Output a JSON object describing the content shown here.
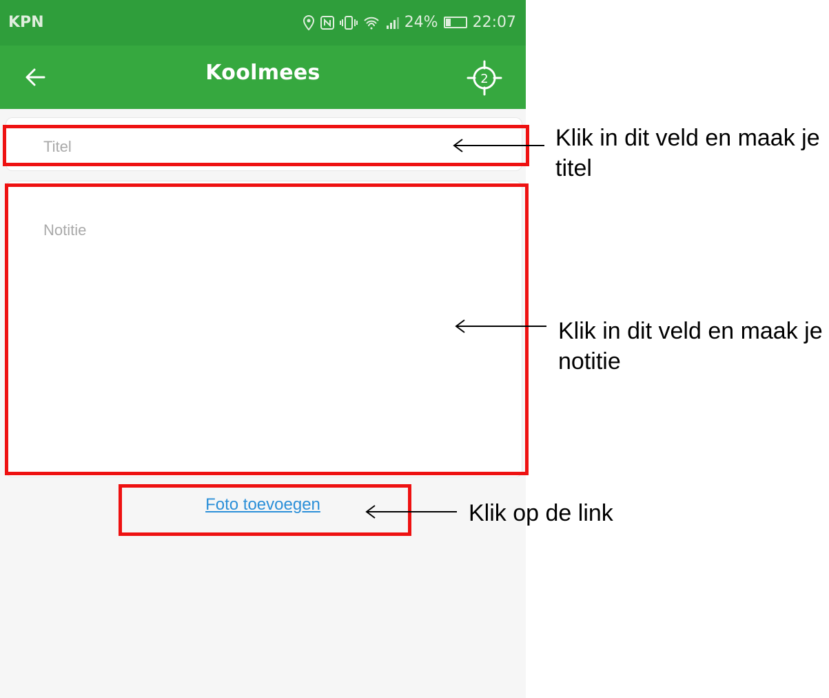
{
  "status_bar": {
    "carrier": "KPN",
    "battery_percent": "24%",
    "battery_level": 0.24,
    "time": "22:07",
    "icons": [
      "location-icon",
      "nfc-icon",
      "vibrate-icon",
      "wifi-icon",
      "signal-icon",
      "battery-icon"
    ]
  },
  "app_bar": {
    "title": "Koolmees",
    "back_icon": "arrow-left-icon",
    "location_icon": "crosshair-target-icon",
    "location_badge": "2"
  },
  "form": {
    "title_placeholder": "Titel",
    "note_placeholder": "Notitie",
    "photo_link": "Foto toevoegen"
  },
  "annotations": {
    "title_instruction": "Klik in dit veld en maak je titel",
    "note_instruction": "Klik in dit veld en maak je notitie",
    "photo_instruction": "Klik op de link"
  },
  "colors": {
    "status_bar": "#2f9e3b",
    "app_bar": "#36a83f",
    "highlight": "#ee1111",
    "link": "#2b8fd8"
  }
}
